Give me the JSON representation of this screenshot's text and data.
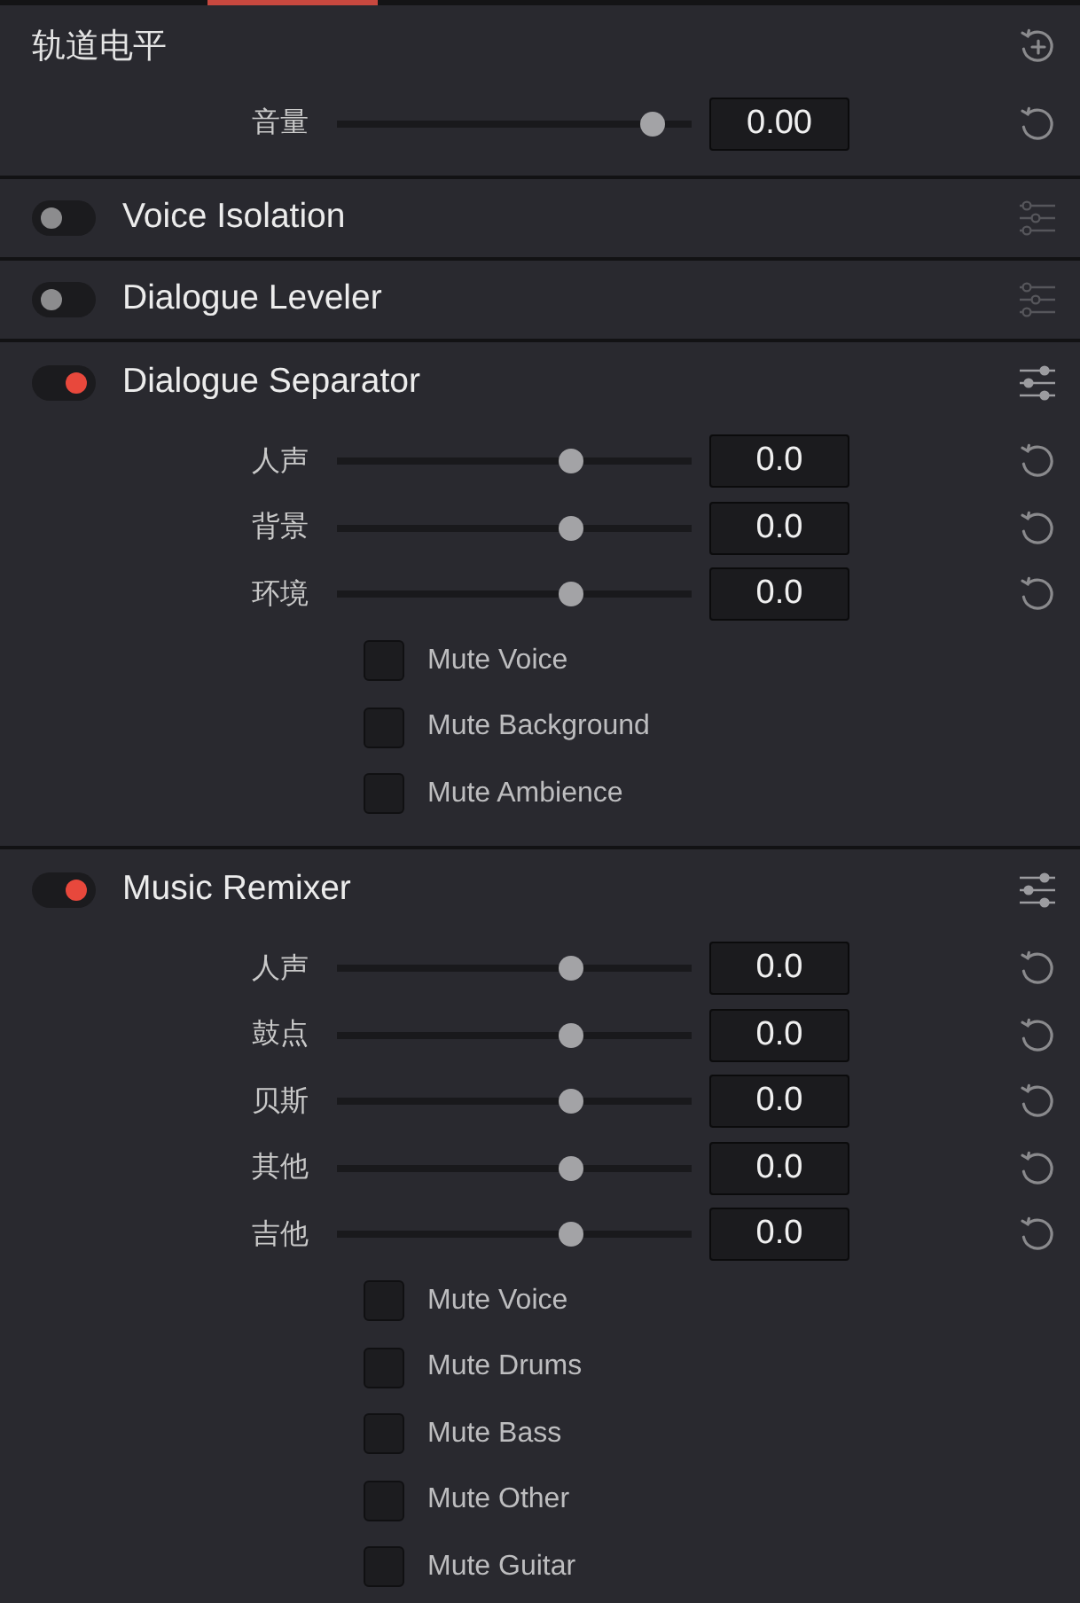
{
  "track_level": {
    "title": "轨道电平",
    "controls": [
      {
        "label": "音量",
        "level": 0.92,
        "value": "0.00"
      }
    ]
  },
  "effects": [
    {
      "name": "Voice Isolation",
      "on": false
    },
    {
      "name": "Dialogue Leveler",
      "on": false
    },
    {
      "name": "Dialogue Separator",
      "on": true,
      "sliders": [
        {
          "label": "人声",
          "level": 0.67,
          "value": "0.0"
        },
        {
          "label": "背景",
          "level": 0.67,
          "value": "0.0"
        },
        {
          "label": "环境",
          "level": 0.67,
          "value": "0.0"
        }
      ],
      "mutes": [
        {
          "label": "Mute Voice",
          "checked": false
        },
        {
          "label": "Mute Background",
          "checked": false
        },
        {
          "label": "Mute Ambience",
          "checked": false
        }
      ]
    },
    {
      "name": "Music Remixer",
      "on": true,
      "sliders": [
        {
          "label": "人声",
          "level": 0.67,
          "value": "0.0"
        },
        {
          "label": "鼓点",
          "level": 0.67,
          "value": "0.0"
        },
        {
          "label": "贝斯",
          "level": 0.67,
          "value": "0.0"
        },
        {
          "label": "其他",
          "level": 0.67,
          "value": "0.0"
        },
        {
          "label": "吉他",
          "level": 0.67,
          "value": "0.0"
        }
      ],
      "mutes": [
        {
          "label": "Mute Voice",
          "checked": false
        },
        {
          "label": "Mute Drums",
          "checked": false
        },
        {
          "label": "Mute Bass",
          "checked": false
        },
        {
          "label": "Mute Other",
          "checked": false
        },
        {
          "label": "Mute Guitar",
          "checked": false
        }
      ]
    }
  ]
}
